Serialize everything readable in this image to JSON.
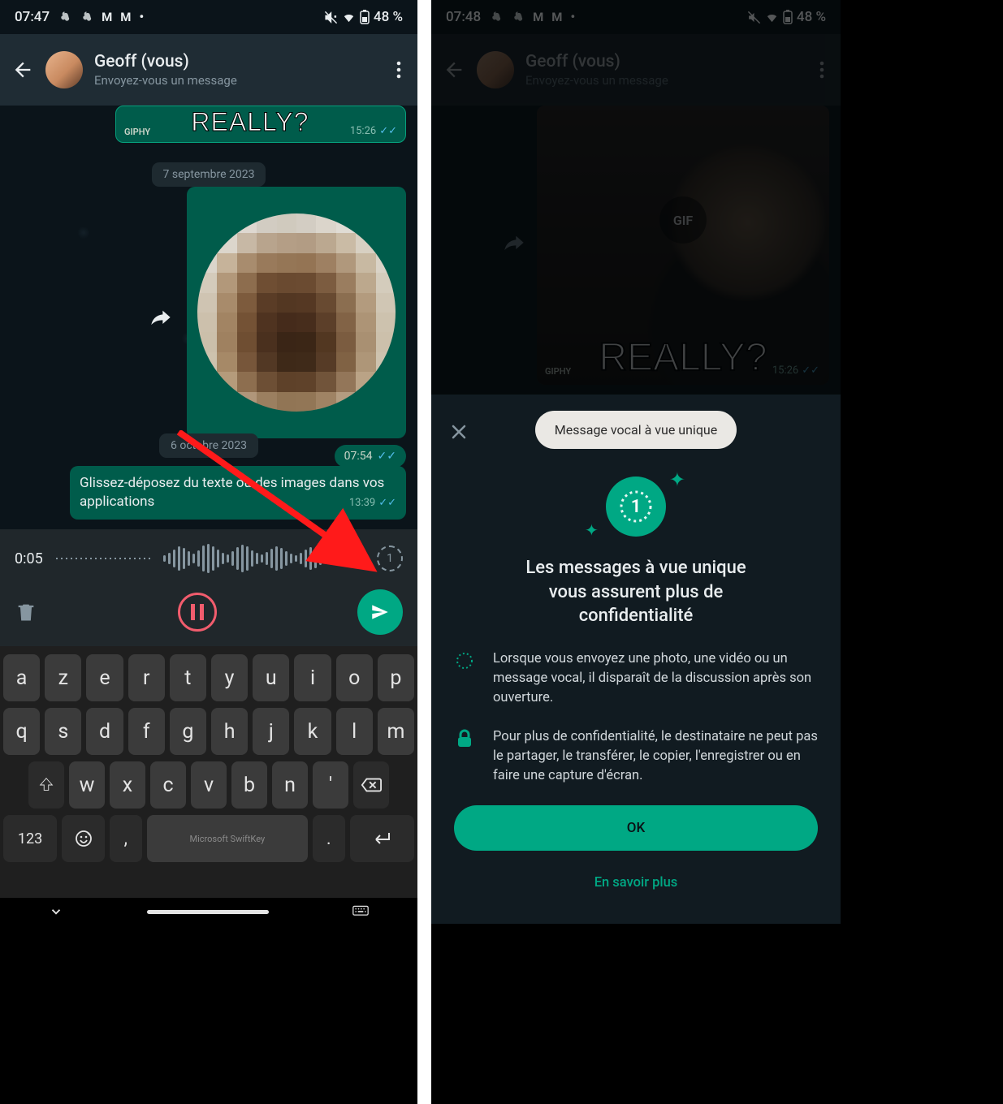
{
  "left": {
    "status": {
      "time": "07:47",
      "battery": "48 %"
    },
    "header": {
      "title": "Geoff (vous)",
      "subtitle": "Envoyez-vous un message"
    },
    "gif_bubble": {
      "source": "GIPHY",
      "caption": "REALLY?",
      "time": "15:26"
    },
    "date1": "7 septembre 2023",
    "photo_time": "07:54",
    "date2": "6 octobre 2023",
    "text_bubble": {
      "text": "Glissez-déposez du texte ou des images dans vos applications",
      "time": "13:39"
    },
    "voice": {
      "duration": "0:05",
      "view_once_digit": "1"
    },
    "keyboard": {
      "row1": [
        "a",
        "z",
        "e",
        "r",
        "t",
        "y",
        "u",
        "i",
        "o",
        "p"
      ],
      "row2": [
        "q",
        "s",
        "d",
        "f",
        "g",
        "h",
        "j",
        "k",
        "l",
        "m"
      ],
      "row3": [
        "w",
        "x",
        "c",
        "v",
        "b",
        "n",
        "'"
      ],
      "numkey": "123",
      "brand": "Microsoft SwiftKey"
    }
  },
  "right": {
    "status": {
      "time": "07:48",
      "battery": "48 %"
    },
    "header": {
      "title": "Geoff (vous)",
      "subtitle": "Envoyez-vous un message"
    },
    "gif": {
      "badge": "GIF",
      "caption": "REALLY?",
      "source": "GIPHY",
      "time": "15:26"
    },
    "sheet": {
      "tooltip": "Message vocal à vue unique",
      "icon_digit": "1",
      "title": "Les messages à vue unique vous assurent plus de confidentialité",
      "item1": "Lorsque vous envoyez une photo, une vidéo ou un message vocal, il disparaît de la discussion après son ouverture.",
      "item2": "Pour plus de confidentialité, le destinataire ne peut pas le partager, le transférer, le copier, l'enregistrer ou en faire une capture d'écran.",
      "ok": "OK",
      "learn_more": "En savoir plus"
    }
  }
}
